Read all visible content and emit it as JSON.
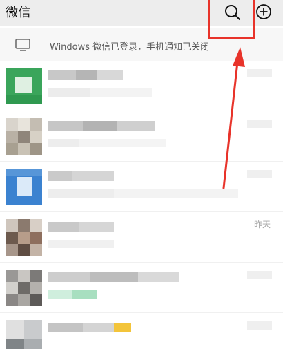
{
  "header": {
    "title": "微信",
    "search_icon": "search-icon",
    "add_icon": "plus-circle-icon",
    "background": "#ededed"
  },
  "login_banner": {
    "text": "Windows 微信已登录，手机通知已关闭",
    "icon": "monitor-icon"
  },
  "chats": [
    {
      "name": "",
      "message": "",
      "time": "",
      "avatar_colors": [
        "#3aa55b",
        "#dff0e2"
      ]
    },
    {
      "name": "",
      "message": "",
      "time": "",
      "avatar_colors": [
        "#b9b1a5",
        "#e2dfd6"
      ]
    },
    {
      "name": "",
      "message": "",
      "time": "",
      "avatar_colors": [
        "#3b82d0",
        "#dbeaf9"
      ]
    },
    {
      "name": "",
      "message": "",
      "time": "昨天",
      "avatar_colors": [
        "#8b7a6e",
        "#cfc6bd"
      ]
    },
    {
      "name": "",
      "message": "",
      "time": "",
      "avatar_colors": [
        "#9a9896",
        "#d2d0cc"
      ]
    },
    {
      "name": "",
      "message": "",
      "time": "",
      "avatar_colors": [
        "#7f8487",
        "#e0e0e0"
      ]
    }
  ],
  "colors": {
    "annotation": "#e8332a",
    "highlight_green": "#8fd3a8",
    "highlight_yellow": "#f3c43a"
  }
}
